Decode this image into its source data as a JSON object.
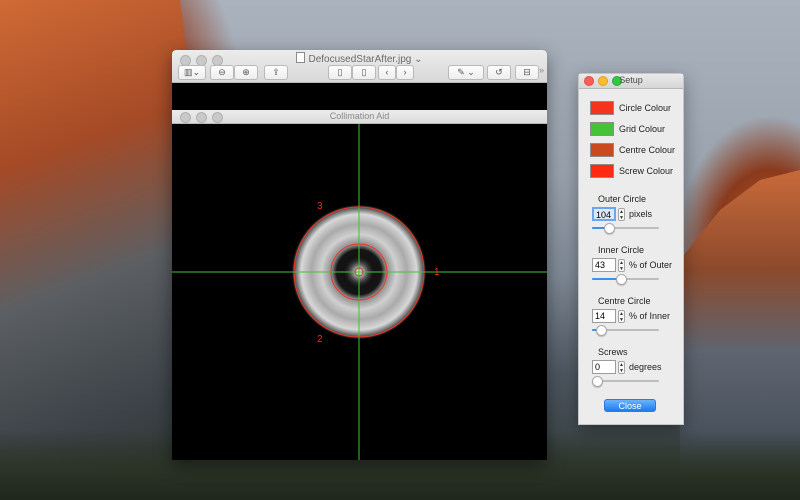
{
  "preview": {
    "filename": "DefocusedStarAfter.jpg",
    "toolbar_icons": [
      "sidebar-icon",
      "zoom-out-icon",
      "zoom-in-icon",
      "share-icon",
      "page-icon",
      "page-icon",
      "back-icon",
      "forward-icon",
      "markup-icon",
      "rotate-icon",
      "toolbox-icon"
    ]
  },
  "collimation": {
    "title": "Collimation Aid",
    "screw_labels": [
      "3",
      "1",
      "2"
    ],
    "circle_colour": "#f5341e",
    "grid_colour": "#45c13a",
    "centre_colour": "#c84a1e",
    "screw_colour": "#ff2a12"
  },
  "setup": {
    "title": "Setup",
    "swatches": [
      {
        "label": "Circle Colour",
        "color": "#f5341e"
      },
      {
        "label": "Grid Colour",
        "color": "#45c13a"
      },
      {
        "label": "Centre Colour",
        "color": "#c84a1e"
      },
      {
        "label": "Screw Colour",
        "color": "#ff2a12"
      }
    ],
    "outer": {
      "label": "Outer Circle",
      "value": "104",
      "unit": "pixels",
      "fraction": 0.25
    },
    "inner": {
      "label": "Inner Circle",
      "value": "43",
      "unit": "% of Outer",
      "fraction": 0.43
    },
    "centre": {
      "label": "Centre Circle",
      "value": "14",
      "unit": "% of Inner",
      "fraction": 0.14
    },
    "screws": {
      "label": "Screws",
      "value": "0",
      "unit": "degrees",
      "fraction": 0.0
    },
    "close_label": "Close"
  }
}
